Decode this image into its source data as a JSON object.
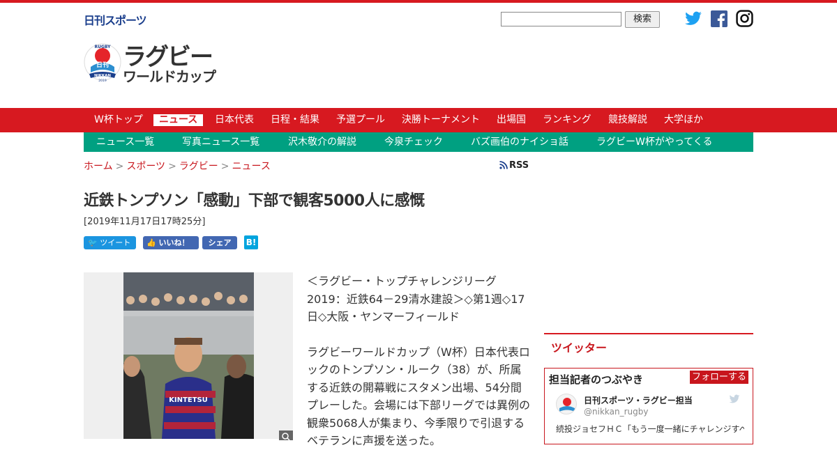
{
  "colors": {
    "brand_red": "#d71920",
    "subnav_green": "#00a081",
    "twitter_blue": "#1da1f2",
    "facebook_blue": "#3b5998"
  },
  "header": {
    "nikkan_logo": "日刊スポーツ",
    "search": {
      "value": "",
      "button_label": "検索"
    },
    "social_icons": [
      "twitter-icon",
      "facebook-icon",
      "instagram-icon"
    ],
    "brand": {
      "line1": "ラグビー",
      "line2": "ワールドカップ",
      "emblem_text": [
        "RUGBY",
        "日刊",
        "NIKKAN",
        "2019"
      ]
    }
  },
  "main_nav": [
    {
      "label": "W杯トップ"
    },
    {
      "label": "ニュース",
      "active": true
    },
    {
      "label": "日本代表"
    },
    {
      "label": "日程・結果"
    },
    {
      "label": "予選プール"
    },
    {
      "label": "決勝トーナメント"
    },
    {
      "label": "出場国"
    },
    {
      "label": "ランキング"
    },
    {
      "label": "競技解説"
    },
    {
      "label": "大学ほか"
    }
  ],
  "sub_nav": [
    {
      "label": "ニュース一覧"
    },
    {
      "label": "写真ニュース一覧"
    },
    {
      "label": "沢木敬介の解説"
    },
    {
      "label": "今泉チェック"
    },
    {
      "label": "バズ画伯のナイショ話"
    },
    {
      "label": "ラグビーW杯がやってくる"
    }
  ],
  "breadcrumb": [
    "ホーム",
    "スポーツ",
    "ラグビー",
    "ニュース"
  ],
  "breadcrumb_sep": ">",
  "rss_label": "RSS",
  "article": {
    "title": "近鉄トンプソン「感動」下部で観客5000人に感慨",
    "date": "[2019年11月17日17時25分]",
    "share": {
      "tweet": "ツイート",
      "like": "いいね！",
      "share": "シェア",
      "hatena": "B!"
    },
    "photo_jersey_text": "KINTETSU",
    "paragraphs": [
      "＜ラグビー・トップチャレンジリーグ2019：近鉄64－29清水建設＞◇第1週◇17日◇大阪・ヤンマーフィールド",
      "ラグビーワールドカップ（W杯）日本代表ロックのトンプソン・ルーク（38）が、所属する近鉄の開幕戦にスタメン出場、54分間プレーした。会場には下部リーグでは異例の観衆5068人が集まり、今季限りで引退するベテランに声援を送った。"
    ]
  },
  "sidebar": {
    "twitter_section_title": "ツイッター",
    "box_title": "担当記者のつぶやき",
    "follow_label": "フォローする",
    "account_name": "日刊スポーツ・ラグビー担当",
    "account_handle": "@nikkan_rugby",
    "tweet_text": "続投ジョセフＨＣ「もう一度一緒にチャレンジすべく」"
  }
}
